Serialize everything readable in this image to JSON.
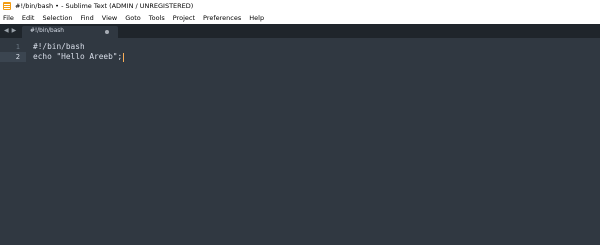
{
  "window": {
    "title": "#!/bin/bash • - Sublime Text (ADMIN / UNREGISTERED)",
    "app_icon": "sublime-text-icon"
  },
  "menu": {
    "items": [
      "File",
      "Edit",
      "Selection",
      "Find",
      "View",
      "Goto",
      "Tools",
      "Project",
      "Preferences",
      "Help"
    ]
  },
  "tabs": {
    "nav_left": "◀",
    "nav_right": "▶",
    "active": {
      "label": "#!/bin/bash",
      "dirty_indicator": "modified-dot-icon"
    }
  },
  "editor": {
    "lines": [
      {
        "number": "1",
        "text": "#!/bin/bash"
      },
      {
        "number": "2",
        "text": "echo \"Hello Areeb\";"
      }
    ],
    "active_line": 2,
    "colors": {
      "background": "#303841",
      "text": "#d8dee9",
      "cursor": "#f9ae58",
      "gutter_text": "#687480"
    }
  }
}
